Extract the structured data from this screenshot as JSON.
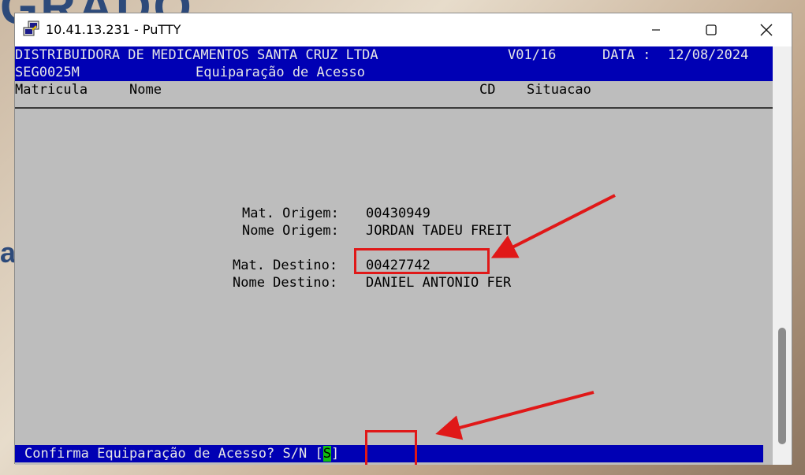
{
  "window": {
    "title": "10.41.13.231 - PuTTY",
    "icons": [
      "putty-icon",
      "minimize-icon",
      "maximize-icon",
      "close-icon"
    ]
  },
  "terminal": {
    "header": {
      "company": "DISTRIBUIDORA DE MEDICAMENTOS SANTA CRUZ LTDA",
      "version": "V01/16",
      "date_label": "DATA :",
      "date": "12/08/2024",
      "program": "SEG0025M",
      "screen_title": "Equiparação de Acesso"
    },
    "columns": {
      "matricula": "Matricula",
      "nome": "Nome",
      "cd": "CD",
      "situacao": "Situacao"
    },
    "form": {
      "mat_origem_label": "Mat. Origem:",
      "mat_origem": "00430949",
      "nome_origem_label": "Nome Origem:",
      "nome_origem": "JORDAN TADEU FREIT",
      "mat_destino_label": "Mat. Destino:",
      "mat_destino": "00427742",
      "nome_destino_label": "Nome Destino:",
      "nome_destino": "DANIEL ANTONIO FER"
    },
    "prompt": {
      "text": "Confirma Equiparação de Acesso? S/N",
      "open_bracket": "[",
      "value": "S",
      "close_bracket": "]"
    }
  },
  "colors": {
    "header_bg": "#0000b4",
    "terminal_bg": "#bdbdbd",
    "cursor": "#10c010",
    "annotation": "#e01818"
  }
}
